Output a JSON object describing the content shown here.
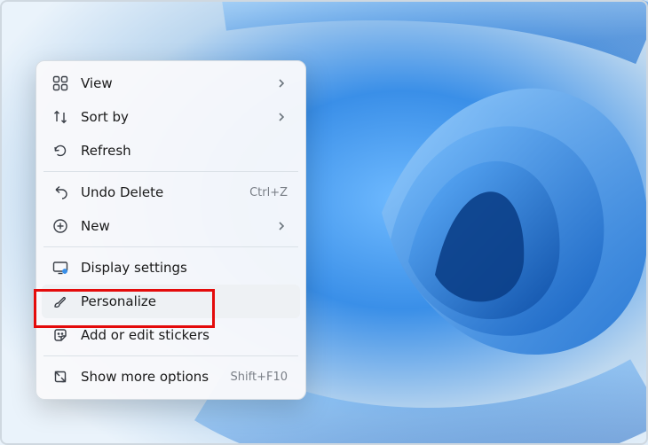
{
  "menu": {
    "items": [
      {
        "label": "View",
        "hasSubmenu": true
      },
      {
        "label": "Sort by",
        "hasSubmenu": true
      },
      {
        "label": "Refresh"
      },
      {
        "label": "Undo Delete",
        "shortcut": "Ctrl+Z"
      },
      {
        "label": "New",
        "hasSubmenu": true
      },
      {
        "label": "Display settings"
      },
      {
        "label": "Personalize",
        "highlighted": true
      },
      {
        "label": "Add or edit stickers"
      },
      {
        "label": "Show more options",
        "shortcut": "Shift+F10"
      }
    ]
  }
}
